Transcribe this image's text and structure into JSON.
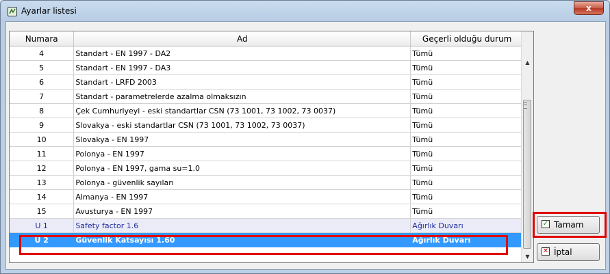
{
  "window": {
    "title": "Ayarlar listesi",
    "close_label": "x"
  },
  "table": {
    "columns": [
      "Numara",
      "Ad",
      "Geçerli olduğu durum"
    ],
    "rows": [
      {
        "num": "4",
        "name": "Standart - EN 1997 - DA2",
        "scope": "Tümü"
      },
      {
        "num": "5",
        "name": "Standart - EN 1997 - DA3",
        "scope": "Tümü"
      },
      {
        "num": "6",
        "name": "Standart - LRFD 2003",
        "scope": "Tümü"
      },
      {
        "num": "7",
        "name": "Standart - parametrelerde azalma olmaksızın",
        "scope": "Tümü"
      },
      {
        "num": "8",
        "name": "Çek Cumhuriyeyi - eski standartlar CSN (73 1001, 73 1002, 73 0037)",
        "scope": "Tümü"
      },
      {
        "num": "9",
        "name": "Slovakya - eski standartlar CSN (73 1001, 73 1002, 73 0037)",
        "scope": "Tümü"
      },
      {
        "num": "10",
        "name": "Slovakya - EN 1997",
        "scope": "Tümü"
      },
      {
        "num": "11",
        "name": "Polonya - EN 1997",
        "scope": "Tümü"
      },
      {
        "num": "12",
        "name": "Polonya - EN 1997, gama su=1.0",
        "scope": "Tümü"
      },
      {
        "num": "13",
        "name": "Polonya - güvenlik sayıları",
        "scope": "Tümü"
      },
      {
        "num": "14",
        "name": "Almanya - EN 1997",
        "scope": "Tümü"
      },
      {
        "num": "15",
        "name": "Avusturya - EN 1997",
        "scope": "Tümü"
      },
      {
        "num": "U 1",
        "name": "Safety factor 1.6",
        "scope": "Ağırlık Duvarı"
      },
      {
        "num": "U 2",
        "name": "Güvenlik Katsayısı 1.60",
        "scope": "Ağırlık Duvarı"
      }
    ],
    "selected_row": "U 2"
  },
  "buttons": {
    "ok_label": "Tamam",
    "cancel_label": "İptal"
  },
  "colors": {
    "selection": "#3399ff",
    "highlight_box": "#e10000",
    "user_row_text": "#1a2a9c"
  }
}
